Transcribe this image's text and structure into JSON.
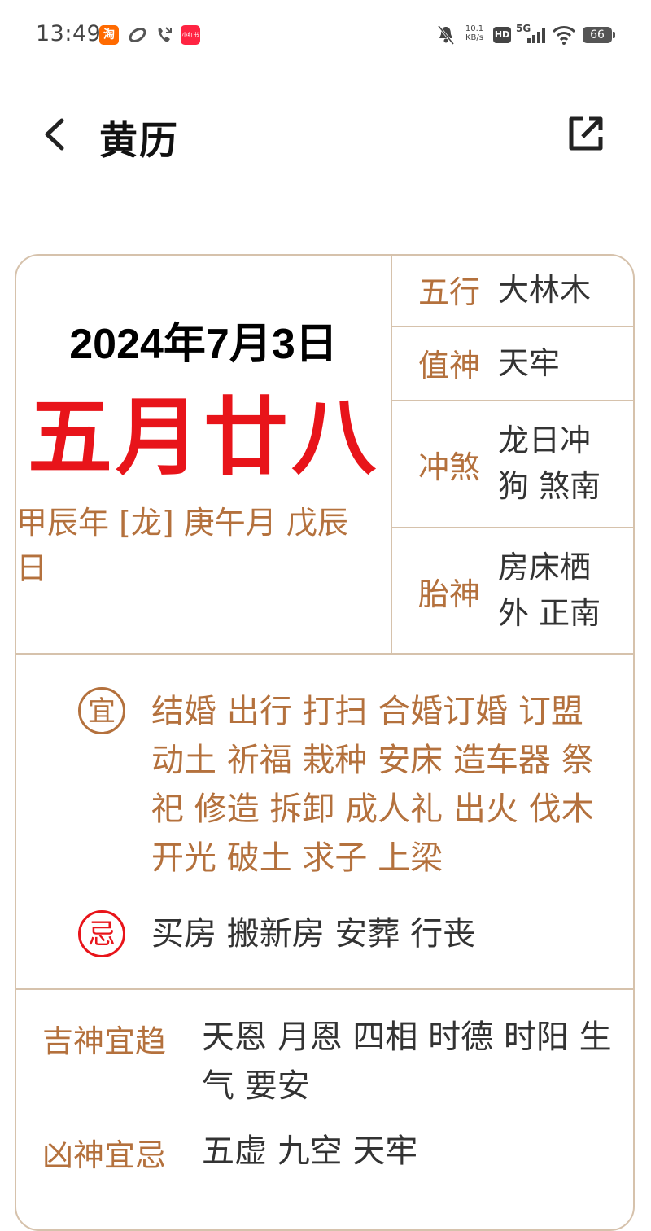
{
  "status_bar": {
    "time": "13:49",
    "taobao_icon": "淘",
    "xiaohongshu_icon": "小红书",
    "net_speed": "10.1",
    "net_unit": "KB/s",
    "hd": "HD",
    "signal": "5G",
    "battery": "66"
  },
  "header": {
    "title": "黄历"
  },
  "date": {
    "gregorian": "2024年7月3日",
    "lunar": "五月廿八",
    "ganzhi": "甲辰年 [龙] 庚午月 戊辰日"
  },
  "info": [
    {
      "label": "五行",
      "value": "大林木"
    },
    {
      "label": "值神",
      "value": "天牢"
    },
    {
      "label": "冲煞",
      "value": "龙日冲狗 煞南"
    },
    {
      "label": "胎神",
      "value": "房床栖外 正南"
    }
  ],
  "yi": {
    "badge": "宜",
    "text": "结婚 出行 打扫 合婚订婚 订盟 动土 祈福 栽种 安床 造车器 祭祀 修造 拆卸 成人礼 出火 伐木 开光 破土 求子 上梁"
  },
  "ji": {
    "badge": "忌",
    "text": "买房 搬新房 安葬 行丧"
  },
  "shen": [
    {
      "label": "吉神宜趋",
      "value": "天恩 月恩 四相 时德 时阳 生气 要安"
    },
    {
      "label": "凶神宜忌",
      "value": "五虚 九空 天牢"
    }
  ],
  "colors": {
    "accent": "#b4713d",
    "lunar_red": "#e8141a",
    "border": "#d6c2ac"
  }
}
